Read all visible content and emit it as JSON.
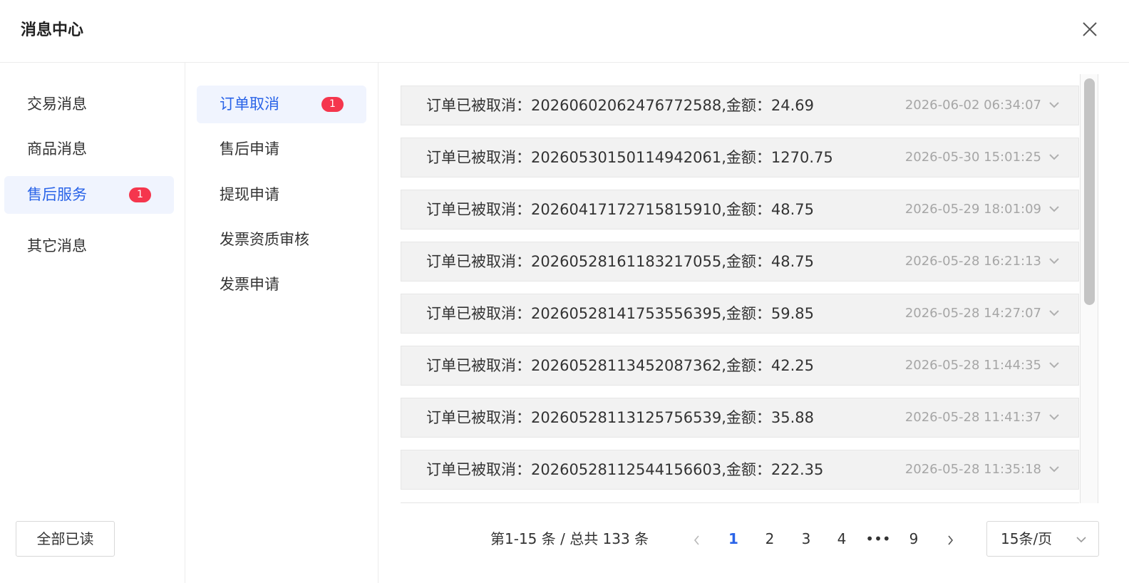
{
  "header": {
    "title": "消息中心"
  },
  "categories": [
    {
      "label": "交易消息",
      "badge": ""
    },
    {
      "label": "商品消息",
      "badge": ""
    },
    {
      "label": "售后服务",
      "badge": "1"
    },
    {
      "label": "其它消息",
      "badge": ""
    }
  ],
  "active_category": "售后服务",
  "read_all_label": "全部已读",
  "subcategories": [
    {
      "label": "订单取消",
      "badge": "1"
    },
    {
      "label": "售后申请",
      "badge": ""
    },
    {
      "label": "提现申请",
      "badge": ""
    },
    {
      "label": "发票资质审核",
      "badge": ""
    },
    {
      "label": "发票申请",
      "badge": ""
    }
  ],
  "active_subcategory": "订单取消",
  "messages": [
    {
      "text": "订单已被取消：2026060206247677258​8,金额：24.69",
      "time": "2026-06-02 06:34:07"
    },
    {
      "text": "订单已被取消：20260530150114942061,金额：1270.75",
      "time": "2026-05-30 15:01:25"
    },
    {
      "text": "订单已被取消：20260417172715815910,金额：48.75",
      "time": "2026-05-29 18:01:09"
    },
    {
      "text": "订单已被取消：20260528161183217055,金额：48.75",
      "time": "2026-05-28 16:21:13"
    },
    {
      "text": "订单已被取消：20260528141753556395,金额：59.85",
      "time": "2026-05-28 14:27:07"
    },
    {
      "text": "订单已被取消：20260528113452087362,金额：42.25",
      "time": "2026-05-28 11:44:35"
    },
    {
      "text": "订单已被取消：20260528113125756539,金额：35.88",
      "time": "2026-05-28 11:41:37"
    },
    {
      "text": "订单已被取消：20260528112544156603,金额：222.35",
      "time": "2026-05-28 11:35:18"
    }
  ],
  "pagination": {
    "summary": "第1-15 条 / 总共 133 条",
    "pages": [
      "1",
      "2",
      "3",
      "4",
      "•••",
      "9"
    ],
    "current_page": "1",
    "page_size": "15条/页"
  },
  "icons": {
    "close": "close-icon",
    "chevron": "chevron-down-icon",
    "prev": "chevron-left-icon",
    "next": "chevron-right-icon"
  },
  "colors": {
    "accent": "#2a64e8",
    "badge": "#f5364d",
    "active_bg": "#f0f4fe",
    "row_bg": "#f2f2f2"
  }
}
